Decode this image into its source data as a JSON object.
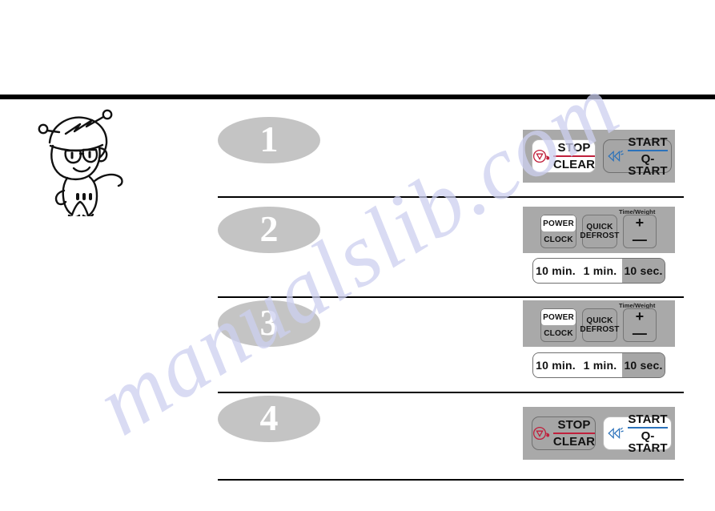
{
  "watermark": {
    "text": "manualslib.com"
  },
  "mascot": {
    "name": "chef-mascot-illustration"
  },
  "steps": [
    {
      "number": "1",
      "panel_type": "start-stop",
      "keys": [
        {
          "name": "stop-clear-button",
          "line1": "STOP",
          "line2": "CLEAR",
          "state": "highlighted",
          "accent": "#c0203c",
          "icon": "stop-sign-icon"
        },
        {
          "name": "start-qstart-button",
          "line1": "START",
          "line2": "Q-START",
          "state": "normal",
          "accent": "#2b72bb",
          "icon": "start-arrows-icon"
        }
      ]
    },
    {
      "number": "2",
      "panel_type": "power-time",
      "keys": [
        {
          "name": "power-button",
          "label": "POWER",
          "state": "highlighted"
        },
        {
          "name": "clock-button",
          "label": "CLOCK",
          "state": "normal"
        },
        {
          "name": "quick-defrost-button",
          "line1": "QUICK",
          "line2": "DEFROST",
          "state": "normal"
        },
        {
          "name": "time-weight-plus-button",
          "label": "+",
          "state": "normal"
        },
        {
          "name": "time-weight-minus-button",
          "label": "—",
          "state": "normal"
        }
      ],
      "time_weight_label": "Time/Weight",
      "timebar": [
        {
          "name": "ten-minutes-button",
          "label": "10 min.",
          "state": "highlighted"
        },
        {
          "name": "one-minute-button",
          "label": "1 min.",
          "state": "highlighted"
        },
        {
          "name": "ten-seconds-button",
          "label": "10 sec.",
          "state": "normal"
        }
      ]
    },
    {
      "number": "3",
      "panel_type": "power-time",
      "keys": [
        {
          "name": "power-button",
          "label": "POWER",
          "state": "highlighted"
        },
        {
          "name": "clock-button",
          "label": "CLOCK",
          "state": "normal"
        },
        {
          "name": "quick-defrost-button",
          "line1": "QUICK",
          "line2": "DEFROST",
          "state": "normal"
        },
        {
          "name": "time-weight-plus-button",
          "label": "+",
          "state": "normal"
        },
        {
          "name": "time-weight-minus-button",
          "label": "—",
          "state": "normal"
        }
      ],
      "time_weight_label": "Time/Weight",
      "timebar": [
        {
          "name": "ten-minutes-button",
          "label": "10 min.",
          "state": "highlighted"
        },
        {
          "name": "one-minute-button",
          "label": "1 min.",
          "state": "highlighted"
        },
        {
          "name": "ten-seconds-button",
          "label": "10 sec.",
          "state": "normal"
        }
      ]
    },
    {
      "number": "4",
      "panel_type": "start-stop",
      "keys": [
        {
          "name": "stop-clear-button",
          "line1": "STOP",
          "line2": "CLEAR",
          "state": "normal",
          "accent": "#c0203c",
          "icon": "stop-sign-icon"
        },
        {
          "name": "start-qstart-button",
          "line1": "START",
          "line2": "Q-START",
          "state": "highlighted",
          "accent": "#2b72bb",
          "icon": "start-arrows-icon"
        }
      ]
    }
  ],
  "colors": {
    "panel_gray": "#a9a9a9",
    "key_gray": "#a6a6a6",
    "badge_gray": "#c4c4c4",
    "stop_red": "#c0203c",
    "start_blue": "#2b72bb",
    "rule_black": "#000000",
    "watermark_blue": "#cdd0f0"
  }
}
